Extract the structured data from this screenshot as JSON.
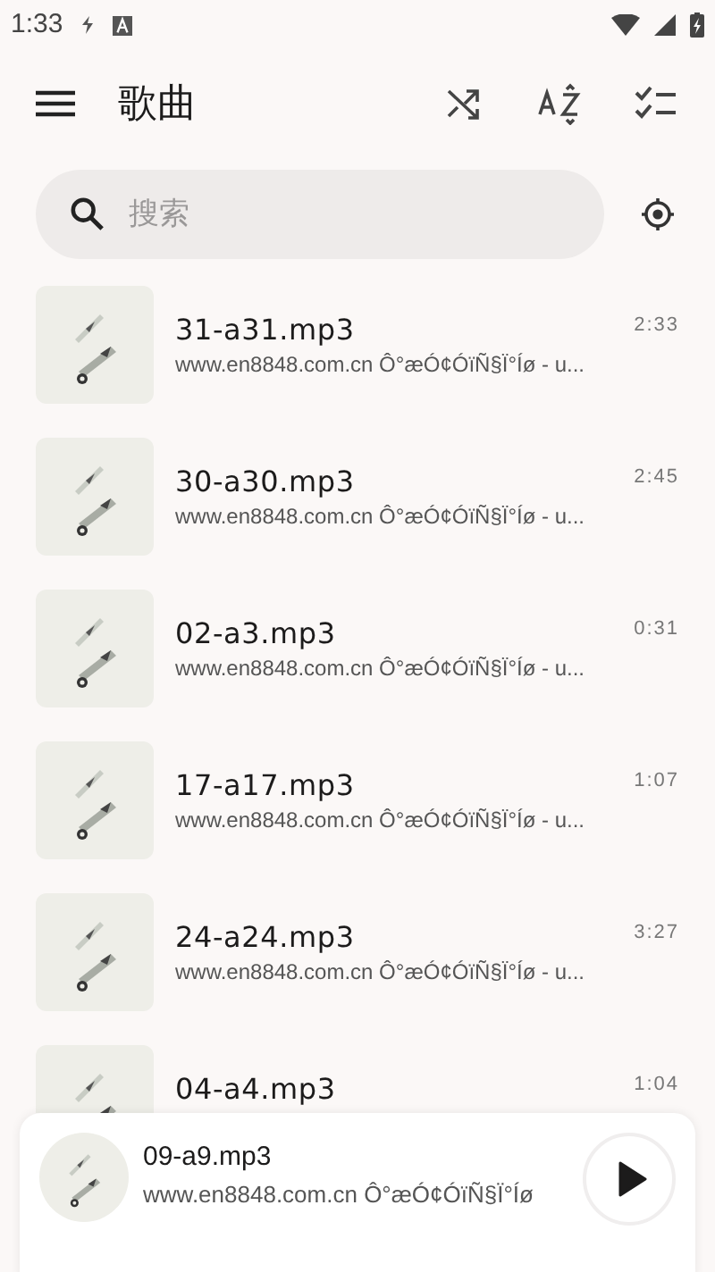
{
  "status_bar": {
    "time": "1:33"
  },
  "app_bar": {
    "title": "歌曲"
  },
  "search": {
    "placeholder": "搜索"
  },
  "songs": [
    {
      "title": "31-a31.mp3",
      "subtitle": "www.en8848.com.cn Ô°æÓ¢ÓïÑ§Ï°Íø - u...",
      "duration": "2:33"
    },
    {
      "title": "30-a30.mp3",
      "subtitle": "www.en8848.com.cn Ô°æÓ¢ÓïÑ§Ï°Íø - u...",
      "duration": "2:45"
    },
    {
      "title": "02-a3.mp3",
      "subtitle": "www.en8848.com.cn Ô°æÓ¢ÓïÑ§Ï°Íø - u...",
      "duration": "0:31"
    },
    {
      "title": "17-a17.mp3",
      "subtitle": "www.en8848.com.cn Ô°æÓ¢ÓïÑ§Ï°Íø - u...",
      "duration": "1:07"
    },
    {
      "title": "24-a24.mp3",
      "subtitle": "www.en8848.com.cn Ô°æÓ¢ÓïÑ§Ï°Íø - u...",
      "duration": "3:27"
    },
    {
      "title": "04-a4.mp3",
      "duration": "1:04"
    }
  ],
  "now_playing": {
    "title": "09-a9.mp3",
    "subtitle": "www.en8848.com.cn Ô°æÓ¢ÓïÑ§Ï°Íø"
  }
}
